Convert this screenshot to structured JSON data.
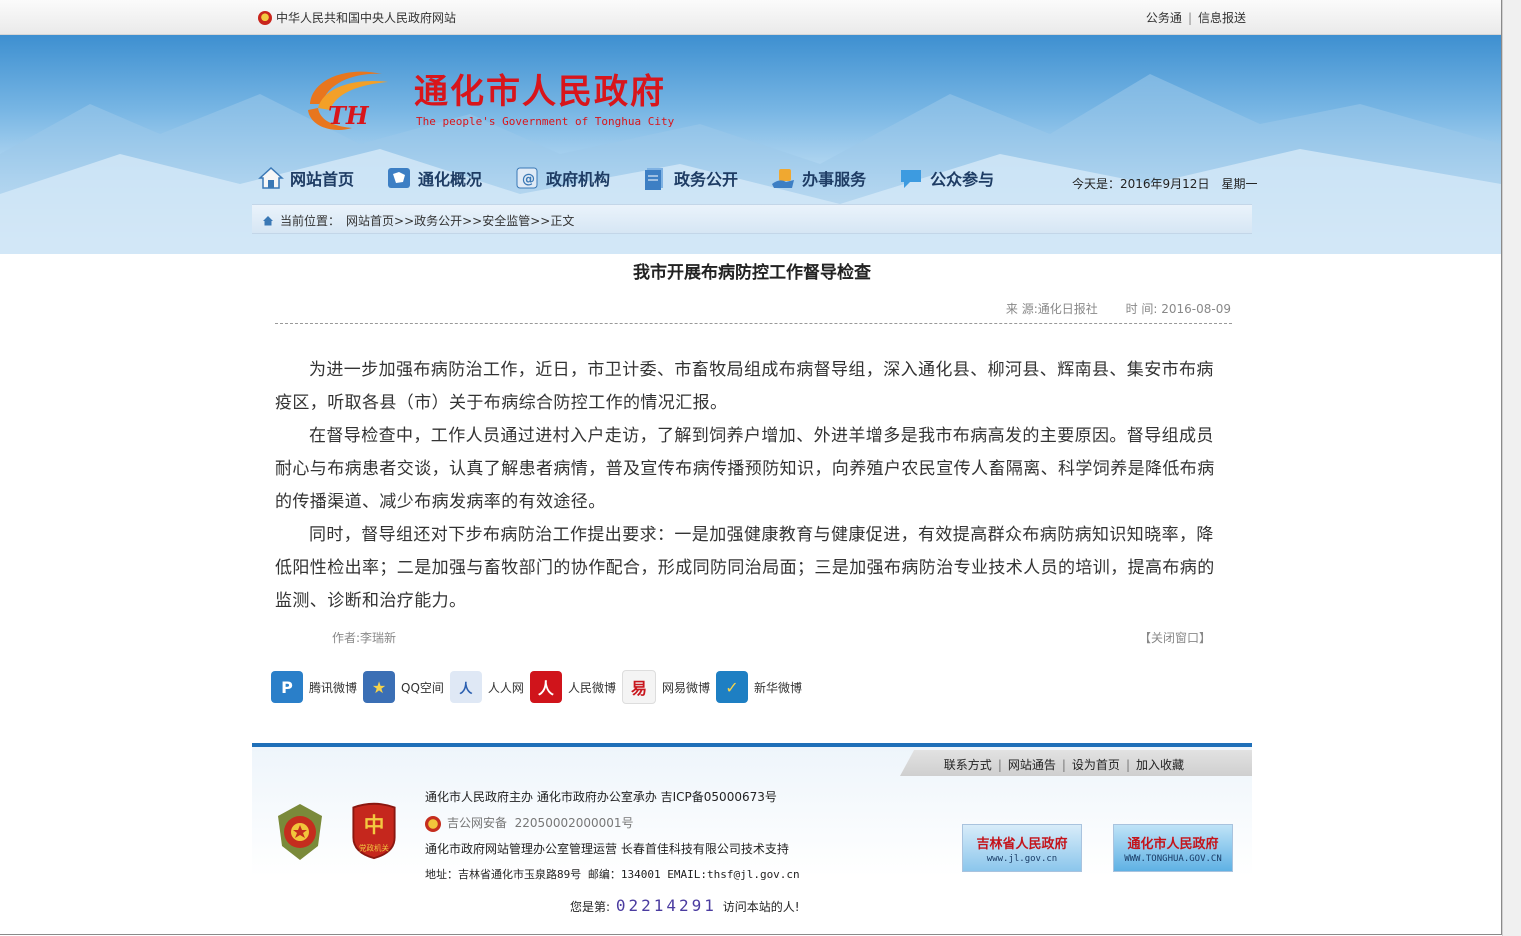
{
  "topbar": {
    "left_text": "中华人民共和国中央人民政府网站",
    "right_links": [
      "公务通",
      "信息报送"
    ]
  },
  "header": {
    "title": "通化市人民政府",
    "subtitle": "The people's Government of Tonghua City"
  },
  "nav": {
    "items": [
      {
        "label": "网站首页",
        "icon": "house-icon"
      },
      {
        "label": "通化概况",
        "icon": "map-icon"
      },
      {
        "label": "政府机构",
        "icon": "org-icon"
      },
      {
        "label": "政务公开",
        "icon": "document-icon"
      },
      {
        "label": "办事服务",
        "icon": "service-icon"
      },
      {
        "label": "公众参与",
        "icon": "speech-bubble-icon"
      }
    ],
    "date_text": "今天是：2016年9月12日　星期一"
  },
  "breadcrumb": {
    "prefix": "当前位置：",
    "path": "网站首页>>政务公开>>安全监管>>正文"
  },
  "article": {
    "title": "我市开展布病防控工作督导检查",
    "source": "来 源:通化日报社",
    "time": "时 间: 2016-08-09",
    "paragraphs": [
      "为进一步加强布病防治工作，近日，市卫计委、市畜牧局组成布病督导组，深入通化县、柳河县、辉南县、集安市布病疫区，听取各县（市）关于布病综合防控工作的情况汇报。",
      "在督导检查中，工作人员通过进村入户走访，了解到饲养户增加、外进羊增多是我市布病高发的主要原因。督导组成员耐心与布病患者交谈，认真了解患者病情，普及宣传布病传播预防知识，向养殖户农民宣传人畜隔离、科学饲养是降低布病的传播渠道、减少布病发病率的有效途径。",
      "同时，督导组还对下步布病防治工作提出要求：一是加强健康教育与健康促进，有效提高群众布病防病知识知晓率，降低阳性检出率；二是加强与畜牧部门的协作配合，形成同防同治局面；三是加强布病防治专业技术人员的培训，提高布病的监测、诊断和治疗能力。"
    ],
    "author": "作者:李瑞新",
    "close_label": "【关闭窗口】"
  },
  "share": {
    "items": [
      {
        "label": "腾讯微博",
        "color": "#2a7fc9",
        "glyph": "P"
      },
      {
        "label": "QQ空间",
        "color": "#3b6fb5",
        "glyph": "★"
      },
      {
        "label": "人人网",
        "color": "#2b5fb0",
        "glyph": "人"
      },
      {
        "label": "人民微博",
        "color": "#d0141b",
        "glyph": "人"
      },
      {
        "label": "网易微博",
        "color": "#c8161d",
        "glyph": "易"
      },
      {
        "label": "新华微博",
        "color": "#1e7fc3",
        "glyph": "✓"
      }
    ]
  },
  "footer": {
    "links": [
      "联系方式",
      "网站通告",
      "设为首页",
      "加入收藏"
    ],
    "line1": "通化市人民政府主办  通化市政府办公室承办  吉ICP备05000673号",
    "line2_label": "吉公网安备",
    "line2_code": "22050002000001号",
    "line3": "通化市政府网站管理办公室管理运营  长春首佳科技有限公司技术支持",
    "line4": "地址：吉林省通化市玉泉路89号  邮编：134001  EMAIL:thsf@jl.gov.cn",
    "banner1": {
      "title": "吉林省人民政府",
      "url": "www.jl.gov.cn"
    },
    "banner2": {
      "title": "通化市人民政府",
      "url": "WWW.TONGHUA.GOV.CN"
    },
    "badge2_text": "党政机关",
    "visits_prefix": "您是第:",
    "visits_count": "02214291",
    "visits_suffix": "访问本站的人!"
  }
}
